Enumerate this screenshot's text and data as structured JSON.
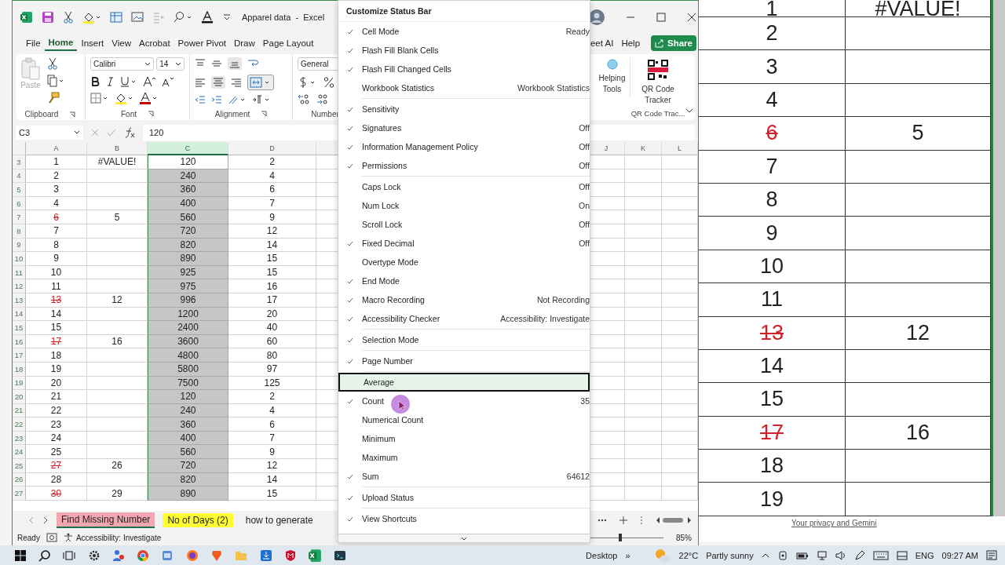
{
  "excel_window": {
    "title": "Apparel data  -  Excel",
    "menu_tabs": [
      {
        "label": "File",
        "selected": false
      },
      {
        "label": "Home",
        "selected": true
      },
      {
        "label": "Insert",
        "selected": false
      },
      {
        "label": "View",
        "selected": false
      },
      {
        "label": "Acrobat",
        "selected": false
      },
      {
        "label": "Power Pivot",
        "selected": false
      },
      {
        "label": "Draw",
        "selected": false
      },
      {
        "label": "Page Layout",
        "selected": false
      }
    ],
    "menu_tabs_right": [
      {
        "label": "eet AI",
        "selected": false
      },
      {
        "label": "Help",
        "selected": false
      }
    ],
    "share_button": "Share",
    "ribbon": {
      "paste": "Paste",
      "font_name": "Calibri",
      "font_size": "14",
      "number_format": "General",
      "groups": [
        "Clipboard",
        "Font",
        "Alignment",
        "Number"
      ],
      "helping_tools": "Helping Tools",
      "qr_button": "QR Code Tracker",
      "qr_group": "QR Code Trac..."
    },
    "formula_bar": {
      "name_box": "C3",
      "formula": "120"
    },
    "columns": [
      {
        "label": "A",
        "selected": false
      },
      {
        "label": "B",
        "selected": false
      },
      {
        "label": "C",
        "selected": true
      },
      {
        "label": "D",
        "selected": false
      }
    ],
    "columns_right": [
      {
        "label": "J",
        "selected": false
      },
      {
        "label": "K",
        "selected": false
      },
      {
        "label": "L",
        "selected": false
      }
    ],
    "rows": [
      {
        "number": "3",
        "a": "1",
        "a_struck": false,
        "b": "#VALUE!",
        "c": "120",
        "d": "2",
        "active_cell": true
      },
      {
        "number": "4",
        "a": "2",
        "a_struck": false,
        "c": "240",
        "d": "4",
        "active_cell": false
      },
      {
        "number": "5",
        "a": "3",
        "a_struck": false,
        "c": "360",
        "d": "6",
        "active_cell": false
      },
      {
        "number": "6",
        "a": "4",
        "a_struck": false,
        "c": "400",
        "d": "7",
        "active_cell": false
      },
      {
        "number": "7",
        "a": "6",
        "a_struck": true,
        "b": "5",
        "c": "560",
        "d": "9",
        "active_cell": false
      },
      {
        "number": "8",
        "a": "7",
        "a_struck": false,
        "c": "720",
        "d": "12",
        "active_cell": false
      },
      {
        "number": "9",
        "a": "8",
        "a_struck": false,
        "c": "820",
        "d": "14",
        "active_cell": false
      },
      {
        "number": "10",
        "a": "9",
        "a_struck": false,
        "c": "890",
        "d": "15",
        "active_cell": false
      },
      {
        "number": "11",
        "a": "10",
        "a_struck": false,
        "c": "925",
        "d": "15",
        "active_cell": false
      },
      {
        "number": "12",
        "a": "11",
        "a_struck": false,
        "c": "975",
        "d": "16",
        "active_cell": false
      },
      {
        "number": "13",
        "a": "13",
        "a_struck": true,
        "b": "12",
        "c": "996",
        "d": "17",
        "active_cell": false
      },
      {
        "number": "14",
        "a": "14",
        "a_struck": false,
        "c": "1200",
        "d": "20",
        "active_cell": false
      },
      {
        "number": "15",
        "a": "15",
        "a_struck": false,
        "c": "2400",
        "d": "40",
        "active_cell": false
      },
      {
        "number": "16",
        "a": "17",
        "a_struck": true,
        "b": "16",
        "c": "3600",
        "d": "60",
        "active_cell": false
      },
      {
        "number": "17",
        "a": "18",
        "a_struck": false,
        "c": "4800",
        "d": "80",
        "active_cell": false
      },
      {
        "number": "18",
        "a": "19",
        "a_struck": false,
        "c": "5800",
        "d": "97",
        "active_cell": false
      },
      {
        "number": "19",
        "a": "20",
        "a_struck": false,
        "c": "7500",
        "d": "125",
        "active_cell": false
      },
      {
        "number": "20",
        "a": "21",
        "a_struck": false,
        "c": "120",
        "d": "2",
        "active_cell": false
      },
      {
        "number": "21",
        "a": "22",
        "a_struck": false,
        "c": "240",
        "d": "4",
        "active_cell": false
      },
      {
        "number": "22",
        "a": "23",
        "a_struck": false,
        "c": "360",
        "d": "6",
        "active_cell": false
      },
      {
        "number": "23",
        "a": "24",
        "a_struck": false,
        "c": "400",
        "d": "7",
        "active_cell": false
      },
      {
        "number": "24",
        "a": "25",
        "a_struck": false,
        "c": "560",
        "d": "9",
        "active_cell": false
      },
      {
        "number": "25",
        "a": "27",
        "a_struck": true,
        "b": "26",
        "c": "720",
        "d": "12",
        "active_cell": false
      },
      {
        "number": "26",
        "a": "28",
        "a_struck": false,
        "c": "820",
        "d": "14",
        "active_cell": false
      },
      {
        "number": "27",
        "a": "30",
        "a_struck": true,
        "b": "29",
        "c": "890",
        "d": "15",
        "active_cell": false
      }
    ],
    "sheet_tabs": [
      {
        "label": "Find Missing Number",
        "selected": true,
        "color": "#f4a7b1"
      },
      {
        "label": "No of Days (2)",
        "selected": false,
        "color": "#ffff33"
      },
      {
        "label": "how to generate",
        "selected": false
      }
    ],
    "status_bar": {
      "mode": "Ready",
      "accessibility": "Accessibility: Investigate",
      "zoom": "85%",
      "zoom_slider": {
        "level": 0.44
      }
    }
  },
  "status_menu": {
    "title": "Customize Status Bar",
    "sections": [
      {
        "items": [
          {
            "label": "Cell Mode",
            "checked": true,
            "selected": false,
            "value": "Ready"
          },
          {
            "label": "Flash Fill Blank Cells",
            "checked": true,
            "selected": false
          },
          {
            "label": "Flash Fill Changed Cells",
            "checked": true,
            "selected": false
          },
          {
            "label": "Workbook Statistics",
            "checked": false,
            "selected": false,
            "value": "Workbook Statistics"
          }
        ]
      },
      {
        "items": [
          {
            "label": "Sensitivity",
            "checked": true,
            "selected": false
          },
          {
            "label": "Signatures",
            "checked": true,
            "selected": false,
            "value": "Off"
          },
          {
            "label": "Information Management Policy",
            "checked": true,
            "selected": false,
            "value": "Off"
          },
          {
            "label": "Permissions",
            "checked": true,
            "selected": false,
            "value": "Off"
          }
        ]
      },
      {
        "items": [
          {
            "label": "Caps Lock",
            "checked": false,
            "selected": false,
            "value": "Off"
          },
          {
            "label": "Num Lock",
            "checked": false,
            "selected": false,
            "value": "On"
          },
          {
            "label": "Scroll Lock",
            "checked": false,
            "selected": false,
            "value": "Off"
          },
          {
            "label": "Fixed Decimal",
            "checked": true,
            "selected": false,
            "value": "Off"
          },
          {
            "label": "Overtype Mode",
            "checked": false,
            "selected": false
          },
          {
            "label": "End Mode",
            "checked": true,
            "selected": false
          },
          {
            "label": "Macro Recording",
            "checked": true,
            "selected": false,
            "value": "Not Recording"
          },
          {
            "label": "Accessibility Checker",
            "checked": true,
            "selected": false,
            "value": "Accessibility: Investigate"
          }
        ]
      },
      {
        "items": [
          {
            "label": "Selection Mode",
            "checked": true,
            "selected": false
          }
        ]
      },
      {
        "items": [
          {
            "label": "Page Number",
            "checked": true,
            "selected": false
          }
        ]
      },
      {
        "items": [
          {
            "label": "Average",
            "checked": false,
            "selected": true
          },
          {
            "label": "Count",
            "checked": true,
            "selected": false,
            "value": "35"
          },
          {
            "label": "Numerical Count",
            "checked": false,
            "selected": false
          },
          {
            "label": "Minimum",
            "checked": false,
            "selected": false
          },
          {
            "label": "Maximum",
            "checked": false,
            "selected": false
          },
          {
            "label": "Sum",
            "checked": true,
            "selected": false,
            "value": "64612"
          }
        ]
      },
      {
        "items": [
          {
            "label": "Upload Status",
            "checked": true,
            "selected": false
          }
        ]
      },
      {
        "items": [
          {
            "label": "View Shortcuts",
            "checked": true,
            "selected": false
          }
        ]
      }
    ]
  },
  "zoom_view": {
    "rows": [
      {
        "a": "1",
        "a_struck": false,
        "b": "#VALUE!"
      },
      {
        "a": "2",
        "a_struck": false
      },
      {
        "a": "3",
        "a_struck": false
      },
      {
        "a": "4",
        "a_struck": false
      },
      {
        "a": "6",
        "a_struck": true,
        "b": "5"
      },
      {
        "a": "7",
        "a_struck": false
      },
      {
        "a": "8",
        "a_struck": false
      },
      {
        "a": "9",
        "a_struck": false
      },
      {
        "a": "10",
        "a_struck": false
      },
      {
        "a": "11",
        "a_struck": false
      },
      {
        "a": "13",
        "a_struck": true,
        "b": "12"
      },
      {
        "a": "14",
        "a_struck": false
      },
      {
        "a": "15",
        "a_struck": false
      },
      {
        "a": "17",
        "a_struck": true,
        "b": "16"
      },
      {
        "a": "18",
        "a_struck": false
      },
      {
        "a": "19",
        "a_struck": false
      }
    ],
    "link": "Your privacy and Gemini"
  },
  "taskbar": {
    "desktop_label": "Desktop",
    "more": "»",
    "temperature": "22°C",
    "weather": "Partly sunny",
    "language": "ENG",
    "time": "09:27 AM"
  }
}
